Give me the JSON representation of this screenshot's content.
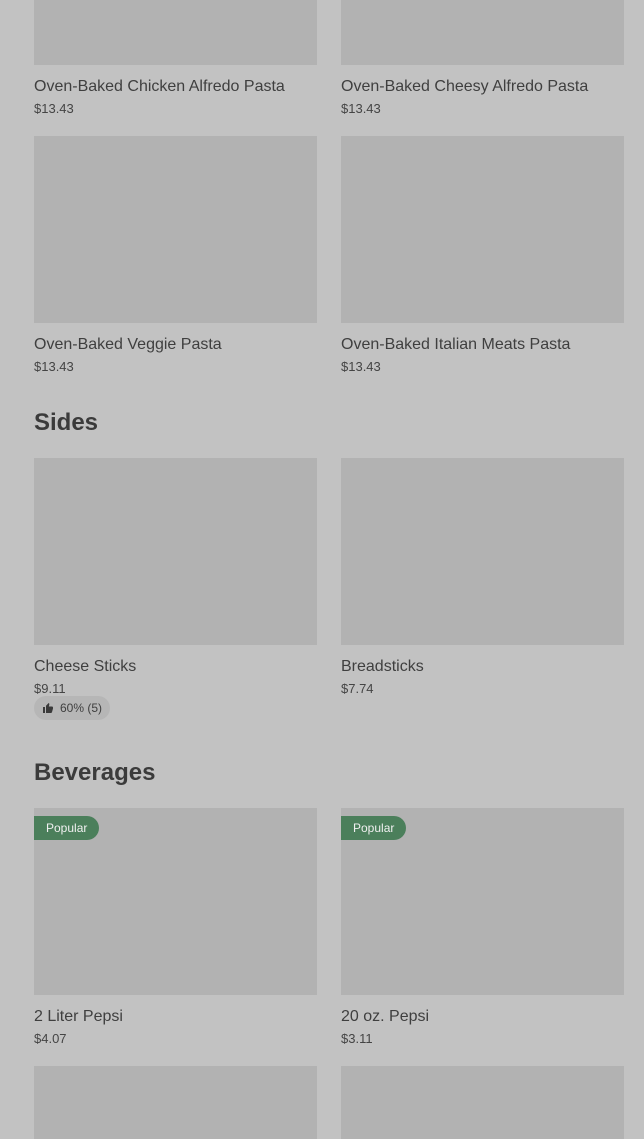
{
  "pasta": {
    "items": [
      {
        "name": "Oven-Baked Chicken Alfredo Pasta",
        "price": "$13.43"
      },
      {
        "name": "Oven-Baked Cheesy Alfredo Pasta",
        "price": "$13.43"
      },
      {
        "name": "Oven-Baked Veggie Pasta",
        "price": "$13.43"
      },
      {
        "name": "Oven-Baked Italian Meats Pasta",
        "price": "$13.43"
      }
    ]
  },
  "sides": {
    "title": "Sides",
    "items": [
      {
        "name": "Cheese Sticks",
        "price": "$9.11",
        "rating": "60% (5)"
      },
      {
        "name": "Breadsticks",
        "price": "$7.74"
      }
    ]
  },
  "beverages": {
    "title": "Beverages",
    "items": [
      {
        "name": "2 Liter Pepsi",
        "price": "$4.07",
        "badge": "Popular"
      },
      {
        "name": "20 oz. Pepsi",
        "price": "$3.11",
        "badge": "Popular"
      }
    ]
  },
  "colors": {
    "background": "#c2c2c2",
    "image_placeholder": "#b2b2b2",
    "popular_badge": "#4b7f5b"
  }
}
